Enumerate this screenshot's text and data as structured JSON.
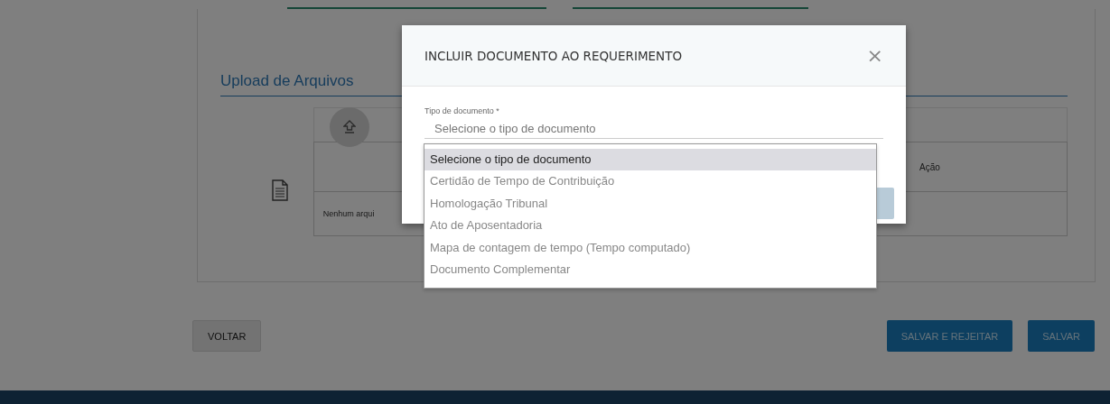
{
  "background": {
    "section_title": "Upload de Arquivos",
    "table": {
      "action_column": "Ação",
      "empty_message": "Nenhum arqui"
    }
  },
  "buttons": [
    {
      "label": "VOLTAR",
      "kind": "secondary"
    },
    {
      "label": "SALVAR E REJEITAR",
      "kind": "primary"
    },
    {
      "label": "SALVAR",
      "kind": "primary"
    }
  ],
  "modal": {
    "title": "INCLUIR DOCUMENTO AO REQUERIMENTO",
    "close": "×",
    "field": {
      "label": "Tipo de documento *",
      "value": "Selecione o tipo de documento"
    },
    "options": [
      {
        "label": "Selecione o tipo de documento",
        "selected": true
      },
      {
        "label": "Certidão de Tempo de Contribuição",
        "selected": false
      },
      {
        "label": "Homologação Tribunal",
        "selected": false
      },
      {
        "label": "Ato de Aposentadoria",
        "selected": false
      },
      {
        "label": "Mapa de contagem de tempo (Tempo computado)",
        "selected": false
      },
      {
        "label": "Documento Complementar",
        "selected": false
      }
    ]
  }
}
